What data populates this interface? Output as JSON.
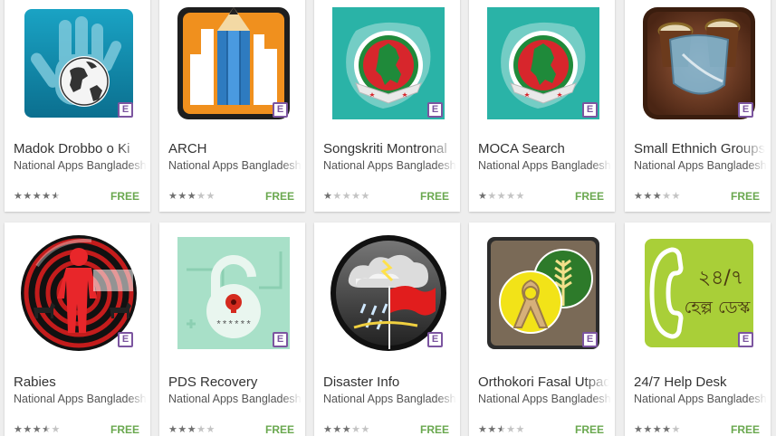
{
  "apps": [
    {
      "title": "Madok Drobbo o Ki",
      "developer": "National Apps Bangladesh",
      "rating": 4.5,
      "price": "FREE",
      "icon": "hand-globe-icon"
    },
    {
      "title": "ARCH",
      "developer": "National Apps Bangladesh",
      "rating": 3,
      "price": "FREE",
      "icon": "pencil-building-icon"
    },
    {
      "title": "Songskriti Montronal",
      "developer": "National Apps Bangladesh",
      "rating": 1,
      "price": "FREE",
      "icon": "bangladesh-map-emblem-icon"
    },
    {
      "title": "MOCA Search",
      "developer": "National Apps Bangladesh",
      "rating": 1,
      "price": "FREE",
      "icon": "bangladesh-map-emblem-icon"
    },
    {
      "title": "Small Ethnich Groups",
      "developer": "National Apps Bangladesh",
      "rating": 3,
      "price": "FREE",
      "icon": "drum-shield-icon"
    },
    {
      "title": "Rabies",
      "developer": "National Apps Bangladesh",
      "rating": 3.5,
      "price": "FREE",
      "icon": "person-dog-radar-icon"
    },
    {
      "title": "PDS Recovery",
      "developer": "National Apps Bangladesh",
      "rating": 3,
      "price": "FREE",
      "icon": "padlock-password-icon"
    },
    {
      "title": "Disaster Info",
      "developer": "National Apps Bangladesh",
      "rating": 3,
      "price": "FREE",
      "icon": "storm-flag-icon"
    },
    {
      "title": "Orthokori Fasal Utpadon",
      "developer": "National Apps Bangladesh",
      "rating": 2.5,
      "price": "FREE",
      "icon": "ribbon-rice-icon"
    },
    {
      "title": "24/7 Help Desk",
      "developer": "National Apps Bangladesh",
      "rating": 4,
      "price": "FREE",
      "icon": "telephone-helpdesk-icon"
    }
  ],
  "badge_letter": "E",
  "icon_text": {
    "helpdesk_line1": "২৪/৭",
    "helpdesk_line2": "হেল্প ডেস্ক",
    "password_mask": "******"
  },
  "colors": {
    "price": "#6aa84f",
    "badge": "#7c55a0",
    "star_on": "#707070",
    "star_off": "#c4c4c4"
  }
}
